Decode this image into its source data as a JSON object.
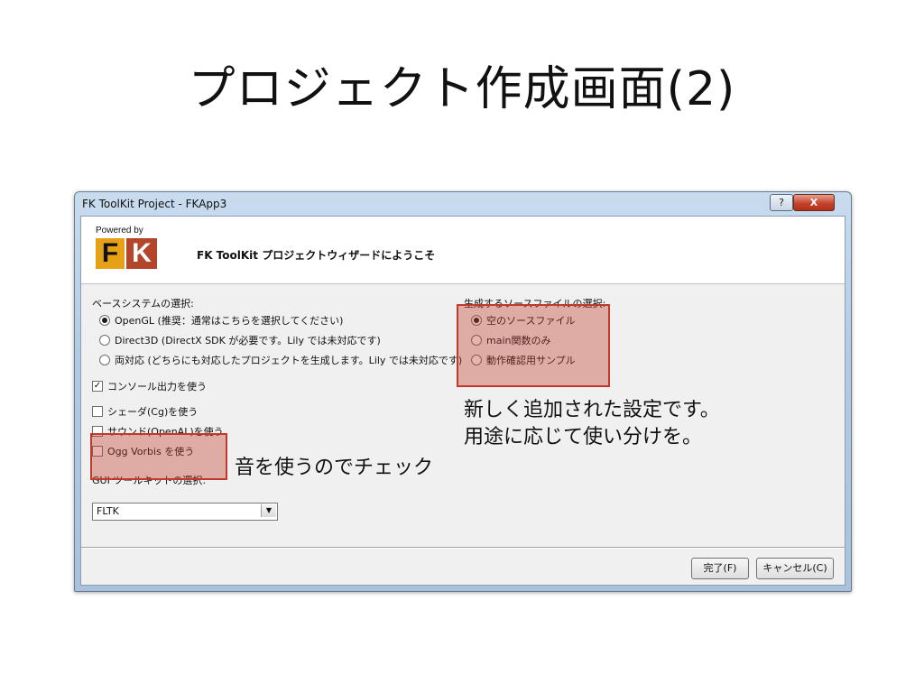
{
  "slide": {
    "title": "プロジェクト作成画面(2)"
  },
  "window": {
    "title": "FK ToolKit Project - FKApp3",
    "help_label": "?",
    "close_label": "X"
  },
  "header": {
    "powered_by": "Powered by",
    "logo_f": "F",
    "logo_k": "K",
    "welcome": "FK ToolKit プロジェクトウィザードにようこそ"
  },
  "base_system": {
    "label": "ベースシステムの選択:",
    "options": [
      {
        "label": "OpenGL (推奨：通常はこちらを選択してください)",
        "selected": true
      },
      {
        "label": "Direct3D (DirectX SDK が必要です。Lily では未対応です)",
        "selected": false
      },
      {
        "label": "両対応 (どちらにも対応したプロジェクトを生成します。Lily では未対応です)",
        "selected": false
      }
    ]
  },
  "source_files": {
    "label": "生成するソースファイルの選択:",
    "options": [
      {
        "label": "空のソースファイル",
        "selected": true
      },
      {
        "label": "main関数のみ",
        "selected": false
      },
      {
        "label": "動作確認用サンプル",
        "selected": false
      }
    ]
  },
  "checkboxes": {
    "console": {
      "label": "コンソール出力を使う",
      "checked": true,
      "mark": "✓"
    },
    "shader": {
      "label": "シェーダ(Cg)を使う",
      "checked": false
    },
    "sound": {
      "label": "サウンド(OpenAL)を使う",
      "checked": false
    },
    "vorbis": {
      "label": "Ogg Vorbis を使う",
      "checked": false
    }
  },
  "gui_toolkit": {
    "label": "GUI ツールキットの選択:",
    "selected": "FLTK",
    "arrow": "▼"
  },
  "buttons": {
    "finish": "完了(F)",
    "cancel": "キャンセル(C)"
  },
  "annotations": {
    "new_settings_line1": "新しく追加された設定です。",
    "new_settings_line2": "用途に応じて使い分けを。",
    "sound_note": "音を使うのでチェック"
  },
  "colors": {
    "highlight": "#c0392b",
    "logo_f": "#e6a117",
    "logo_k": "#b3452b"
  }
}
